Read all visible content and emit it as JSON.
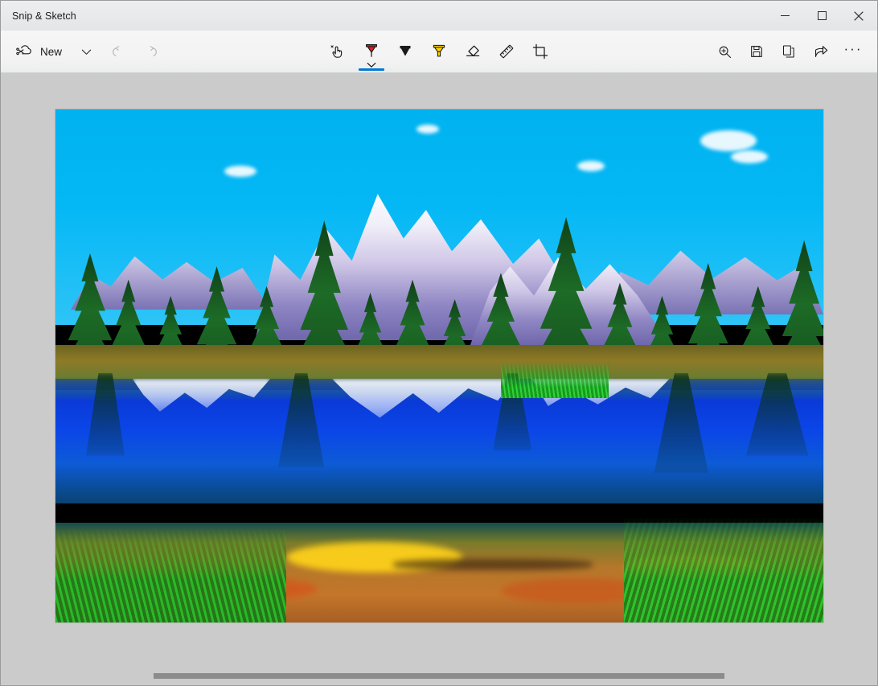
{
  "window": {
    "title": "Snip & Sketch",
    "controls": [
      {
        "name": "minimize",
        "label": "Minimize",
        "glyph": "minimize-icon"
      },
      {
        "name": "maximize",
        "label": "Maximize",
        "glyph": "maximize-icon"
      },
      {
        "name": "close",
        "label": "Close",
        "glyph": "close-icon"
      }
    ]
  },
  "toolbar": {
    "new_label": "New",
    "new_icon": "new-snip-icon",
    "new_dropdown_icon": "chevron-down-icon",
    "undo_label": "Undo",
    "undo_icon": "undo-icon",
    "undo_disabled": true,
    "redo_label": "Redo",
    "redo_icon": "redo-icon",
    "redo_disabled": true,
    "tools": [
      {
        "id": "touch-writing",
        "label": "Touch writing",
        "icon": "touch-writing-icon",
        "active": false,
        "color": "#1a1a1a",
        "has_chevron": false
      },
      {
        "id": "ballpoint-pen",
        "label": "Ballpoint pen",
        "icon": "ballpoint-pen-icon",
        "active": true,
        "color": "#e01b24",
        "has_chevron": true
      },
      {
        "id": "pencil",
        "label": "Pencil",
        "icon": "pencil-tool-icon",
        "active": false,
        "color": "#1a1a1a",
        "has_chevron": false
      },
      {
        "id": "highlighter",
        "label": "Highlighter",
        "icon": "highlighter-icon",
        "active": false,
        "color": "#ffd400",
        "has_chevron": false
      },
      {
        "id": "eraser",
        "label": "Eraser",
        "icon": "eraser-icon",
        "active": false,
        "color": "#1a1a1a",
        "has_chevron": false
      },
      {
        "id": "ruler",
        "label": "Ruler",
        "icon": "ruler-icon",
        "active": false,
        "color": "#1a1a1a",
        "has_chevron": false
      },
      {
        "id": "crop",
        "label": "Image crop",
        "icon": "crop-icon",
        "active": false,
        "color": "#1a1a1a",
        "has_chevron": false
      }
    ],
    "actions": [
      {
        "id": "zoom",
        "label": "Zoom",
        "icon": "zoom-in-icon"
      },
      {
        "id": "save",
        "label": "Save as",
        "icon": "save-icon"
      },
      {
        "id": "copy",
        "label": "Copy",
        "icon": "copy-icon"
      },
      {
        "id": "share",
        "label": "Share",
        "icon": "share-icon"
      },
      {
        "id": "more",
        "label": "See more",
        "icon": "ellipsis-icon",
        "text": "···"
      }
    ]
  },
  "canvas": {
    "image_alt": "Snow-capped Grand Teton mountains with pine forest reflected in a clear lake with orange rocks",
    "background_color": "#cbcbcb",
    "scrollbar": {
      "name": "horizontal-scrollbar",
      "orientation": "horizontal"
    }
  },
  "palette": {
    "sky": "#00b2f0",
    "mountain_snow": "#ffffff",
    "mountain_shadow": "#7a72b4",
    "forest_green": "#1d6b26",
    "meadow_green": "#5fbf2c",
    "water_blue": "#0b46e8",
    "rock_orange": "#c4762a",
    "grass_green": "#32d13a",
    "accent": "#0078d4",
    "toolbar_bg": "#f3f3f3",
    "titlebar_bg": "#e7e9eb"
  }
}
